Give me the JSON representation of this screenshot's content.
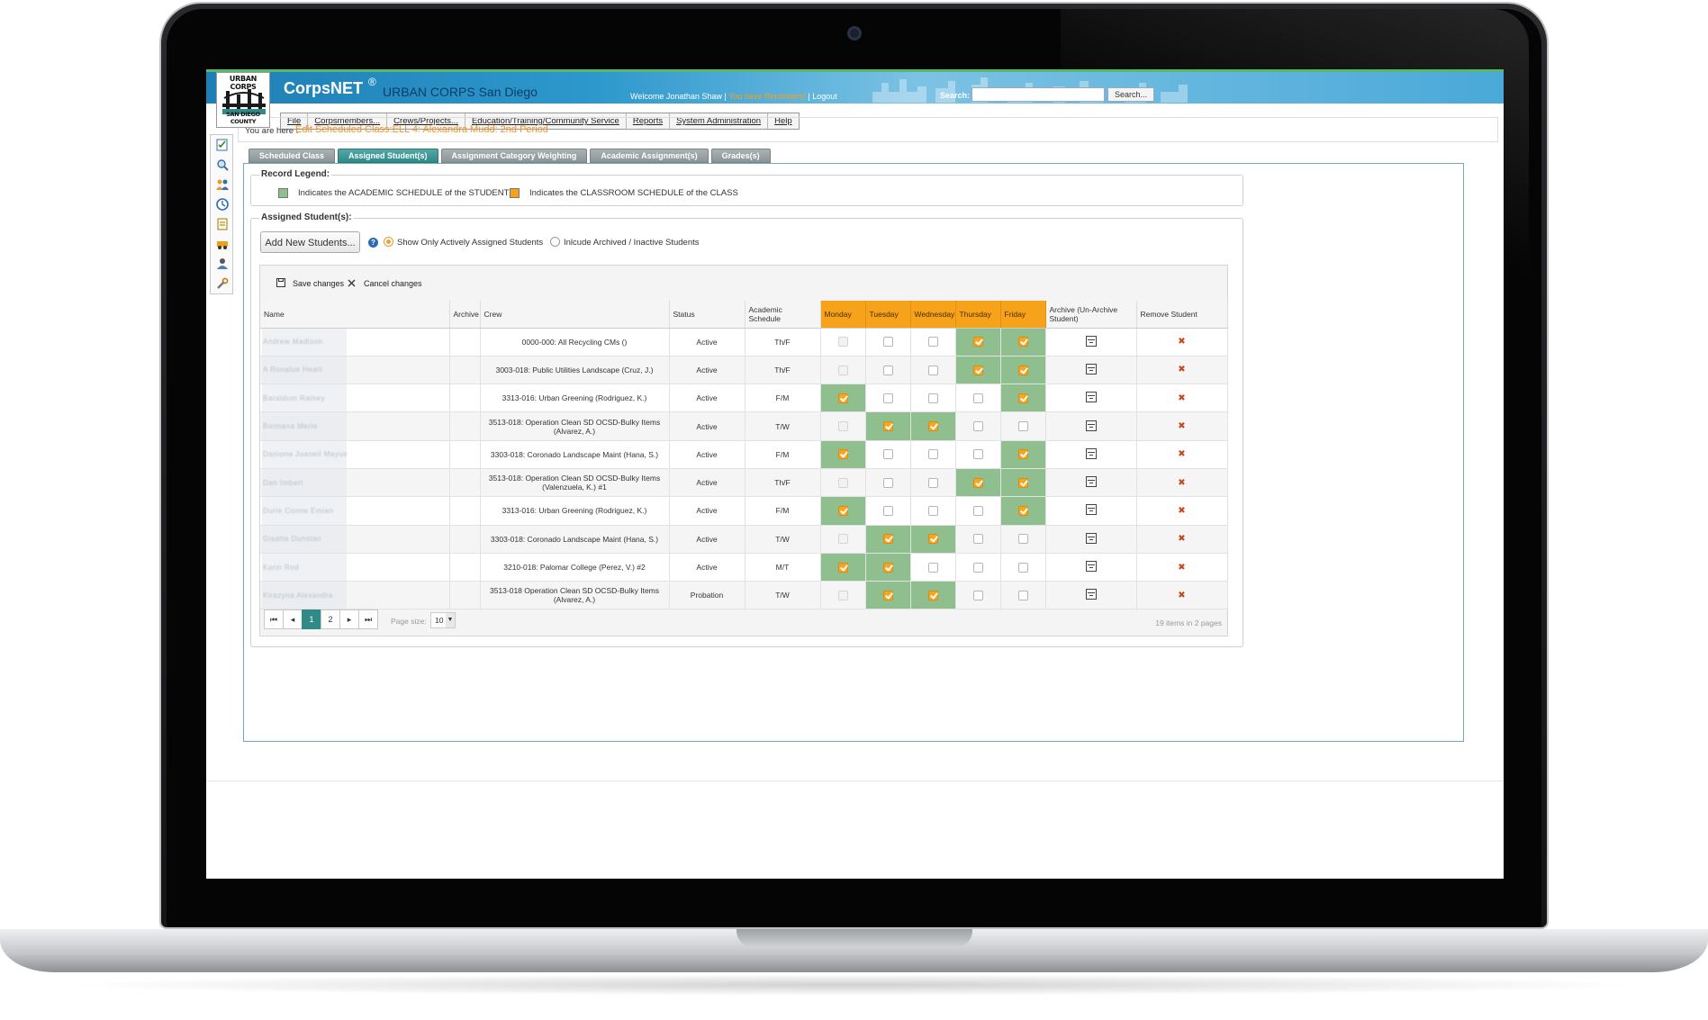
{
  "colors": {
    "accent_orange": "#f7a21b",
    "academic_green": "#8fbf8f",
    "tab_active": "#2f8a88",
    "header_blue": "#2d98cc"
  },
  "header": {
    "logo_top": "URBAN CORPS",
    "logo_bottom": "SAN DIEGO COUNTY",
    "app_name": "CorpsNET",
    "registered": "®",
    "org": "URBAN CORPS San Diego",
    "welcome": "Welcome Jonathan Shaw",
    "reminders": "You have Reminders!",
    "logout": "Logout",
    "search_label": "Search:",
    "search_value": "",
    "search_button": "Search..."
  },
  "menu": [
    "File",
    "Corpsmembers...",
    "Crews/Projects...",
    "Education/Training/Community Service",
    "Reports",
    "System Administration",
    "Help"
  ],
  "sidebar_icons": [
    "checklist-icon",
    "magnifier-icon",
    "people-icon",
    "clock-icon",
    "notepad-icon",
    "vehicle-icon",
    "group-icon",
    "tools-icon"
  ],
  "breadcrumb": {
    "label": "You are here :",
    "title": "Edit Scheduled Class:ELL 4: Alexandra Mudd: 2nd Period"
  },
  "tabs": [
    "Scheduled Class",
    "Assigned Student(s)",
    "Assignment Category Weighting",
    "Academic Assignment(s)",
    "Grades(s)"
  ],
  "active_tab": 1,
  "legend": {
    "title": "Record Legend:",
    "academic": "Indicates the ACADEMIC SCHEDULE of the STUDENT",
    "classroom": "Indicates the CLASSROOM SCHEDULE of the CLASS"
  },
  "assigned": {
    "title": "Assigned Student(s):",
    "add_button": "Add New Students...",
    "radio_active": "Show Only Actively Assigned Students",
    "radio_archived": "Inlcude Archived / Inactive Students",
    "radio_selected": "active"
  },
  "grid": {
    "save": "Save changes",
    "cancel": "Cancel changes",
    "columns": [
      "Name",
      "Archive",
      "Crew",
      "Status",
      "Academic Schedule",
      "Monday",
      "Tuesday",
      "Wednesday",
      "Thursday",
      "Friday",
      "Archive (Un-Archive Student)",
      "Remove Student"
    ],
    "rows": [
      {
        "name": "Andrew Madison",
        "crew": "0000-000: All Recycling CMs ()",
        "status": "Active",
        "schedule": "Th/F",
        "days": [
          0,
          0,
          0,
          1,
          1
        ],
        "academic": [
          0,
          0,
          0,
          1,
          1
        ]
      },
      {
        "name": "A Ronalue Heart",
        "crew": "3003-018: Public Utilities Landscape (Cruz, J.)",
        "status": "Active",
        "schedule": "Th/F",
        "days": [
          0,
          0,
          0,
          1,
          1
        ],
        "academic": [
          0,
          0,
          0,
          1,
          1
        ]
      },
      {
        "name": "Baraldum Rainey",
        "crew": "3313-016: Urban Greening (Rodriguez, K.)",
        "status": "Active",
        "schedule": "F/M",
        "days": [
          1,
          0,
          0,
          0,
          1
        ],
        "academic": [
          1,
          0,
          0,
          0,
          1
        ]
      },
      {
        "name": "Bonnana Merle",
        "crew": "3513-018: Operation Clean SD OCSD-Bulky Items (Alvarez, A.)",
        "status": "Active",
        "schedule": "T/W",
        "days": [
          0,
          1,
          1,
          0,
          0
        ],
        "academic": [
          0,
          1,
          1,
          0,
          0
        ]
      },
      {
        "name": "Daniona Juaneil Mayue",
        "crew": "3303-018: Coronado Landscape Maint (Hana, S.)",
        "status": "Active",
        "schedule": "F/M",
        "days": [
          1,
          0,
          0,
          0,
          1
        ],
        "academic": [
          1,
          0,
          0,
          0,
          1
        ]
      },
      {
        "name": "Dan Imbert",
        "crew": "3513-018: Operation Clean SD OCSD-Bulky Items (Valenzuela, K.) #1",
        "status": "Active",
        "schedule": "Th/F",
        "days": [
          0,
          0,
          0,
          1,
          1
        ],
        "academic": [
          0,
          0,
          0,
          1,
          1
        ]
      },
      {
        "name": "Durie Conne Emian",
        "crew": "3313-016: Urban Greening (Rodriguez, K.)",
        "status": "Active",
        "schedule": "F/M",
        "days": [
          1,
          0,
          0,
          0,
          1
        ],
        "academic": [
          1,
          0,
          0,
          0,
          1
        ]
      },
      {
        "name": "Gisatte Dunstan",
        "crew": "3303-018: Coronado Landscape Maint (Hana, S.)",
        "status": "Active",
        "schedule": "T/W",
        "days": [
          0,
          1,
          1,
          0,
          0
        ],
        "academic": [
          0,
          1,
          1,
          0,
          0
        ]
      },
      {
        "name": "Karin Rod",
        "crew": "3210-018: Palomar College (Perez, V.) #2",
        "status": "Active",
        "schedule": "M/T",
        "days": [
          1,
          1,
          0,
          0,
          0
        ],
        "academic": [
          1,
          1,
          0,
          0,
          0
        ]
      },
      {
        "name": "Kirazyna Alexandra",
        "crew": "3513-018 Operation Clean SD OCSD-Bulky Items (Alvarez, A.)",
        "status": "Probation",
        "schedule": "T/W",
        "days": [
          0,
          1,
          1,
          0,
          0
        ],
        "academic": [
          0,
          1,
          1,
          0,
          0
        ]
      }
    ],
    "pager": {
      "pages": [
        "1",
        "2"
      ],
      "current": "1",
      "page_size_label": "Page size:",
      "page_size": "10",
      "info": "19 items in 2 pages"
    }
  }
}
